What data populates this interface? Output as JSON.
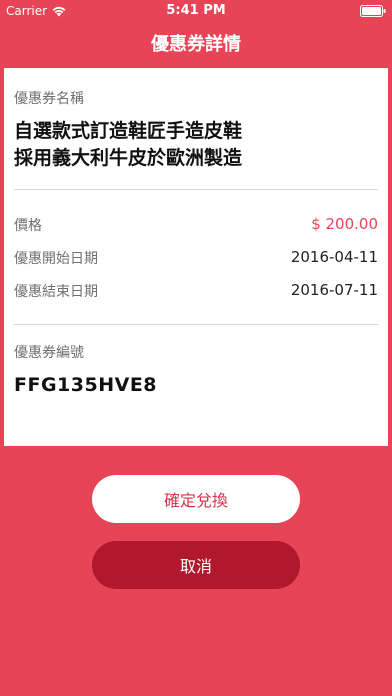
{
  "status_bar": {
    "carrier": "Carrier",
    "time": "5:41 PM",
    "wifi_icon": "wifi-icon",
    "battery_icon": "battery-icon"
  },
  "nav": {
    "title": "優惠券詳情"
  },
  "coupon": {
    "name_label": "優惠券名稱",
    "name_line1": "自選款式訂造鞋匠手造皮鞋",
    "name_line2": "採用義大利牛皮於歐洲製造",
    "price_label": "價格",
    "price_value": "$ 200.00",
    "start_label": "優惠開始日期",
    "start_value": "2016-04-11",
    "end_label": "優惠結束日期",
    "end_value": "2016-07-11",
    "code_label": "優惠券編號",
    "code_value": "FFG135HVE8"
  },
  "actions": {
    "confirm_label": "確定兌換",
    "cancel_label": "取消"
  },
  "colors": {
    "background": "#E84457",
    "price": "#E84457",
    "cancel_button": "#B0182D",
    "confirm_text": "#D9324A"
  }
}
